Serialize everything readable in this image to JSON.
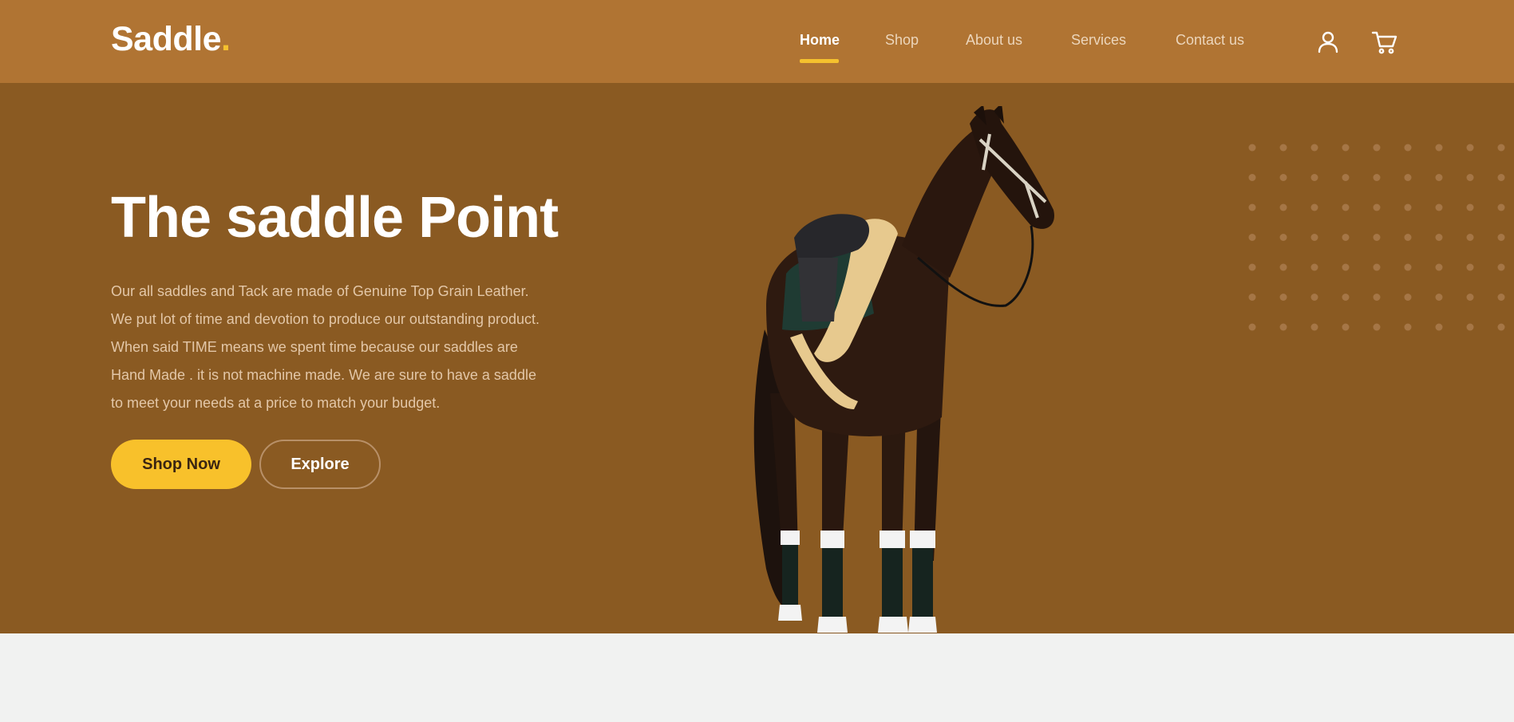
{
  "brand": {
    "name": "Saddle",
    "dot": "."
  },
  "nav": {
    "items": [
      {
        "label": "Home",
        "active": true
      },
      {
        "label": "Shop",
        "active": false
      },
      {
        "label": "About us",
        "active": false
      },
      {
        "label": "Services",
        "active": false
      },
      {
        "label": "Contact us",
        "active": false
      }
    ],
    "icons": [
      "user-icon",
      "cart-icon"
    ]
  },
  "hero": {
    "title": "The saddle Point",
    "description_lines": [
      "Our all saddles and Tack are made of Genuine Top Grain Leather.",
      "We put lot of time and devotion to produce our outstanding product.",
      "When said TIME means we spent time because our saddles are",
      "Hand Made . it is not machine made. We are sure to have a saddle",
      "to meet your needs at a price to match your budget."
    ],
    "primary_button": "Shop Now",
    "secondary_button": "Explore",
    "image": "saddled-horse-illustration"
  },
  "colors": {
    "header_bg": "#b07433",
    "hero_bg": "#8a5a22",
    "accent": "#f8c12b",
    "page_bg": "#f1f2f1"
  }
}
